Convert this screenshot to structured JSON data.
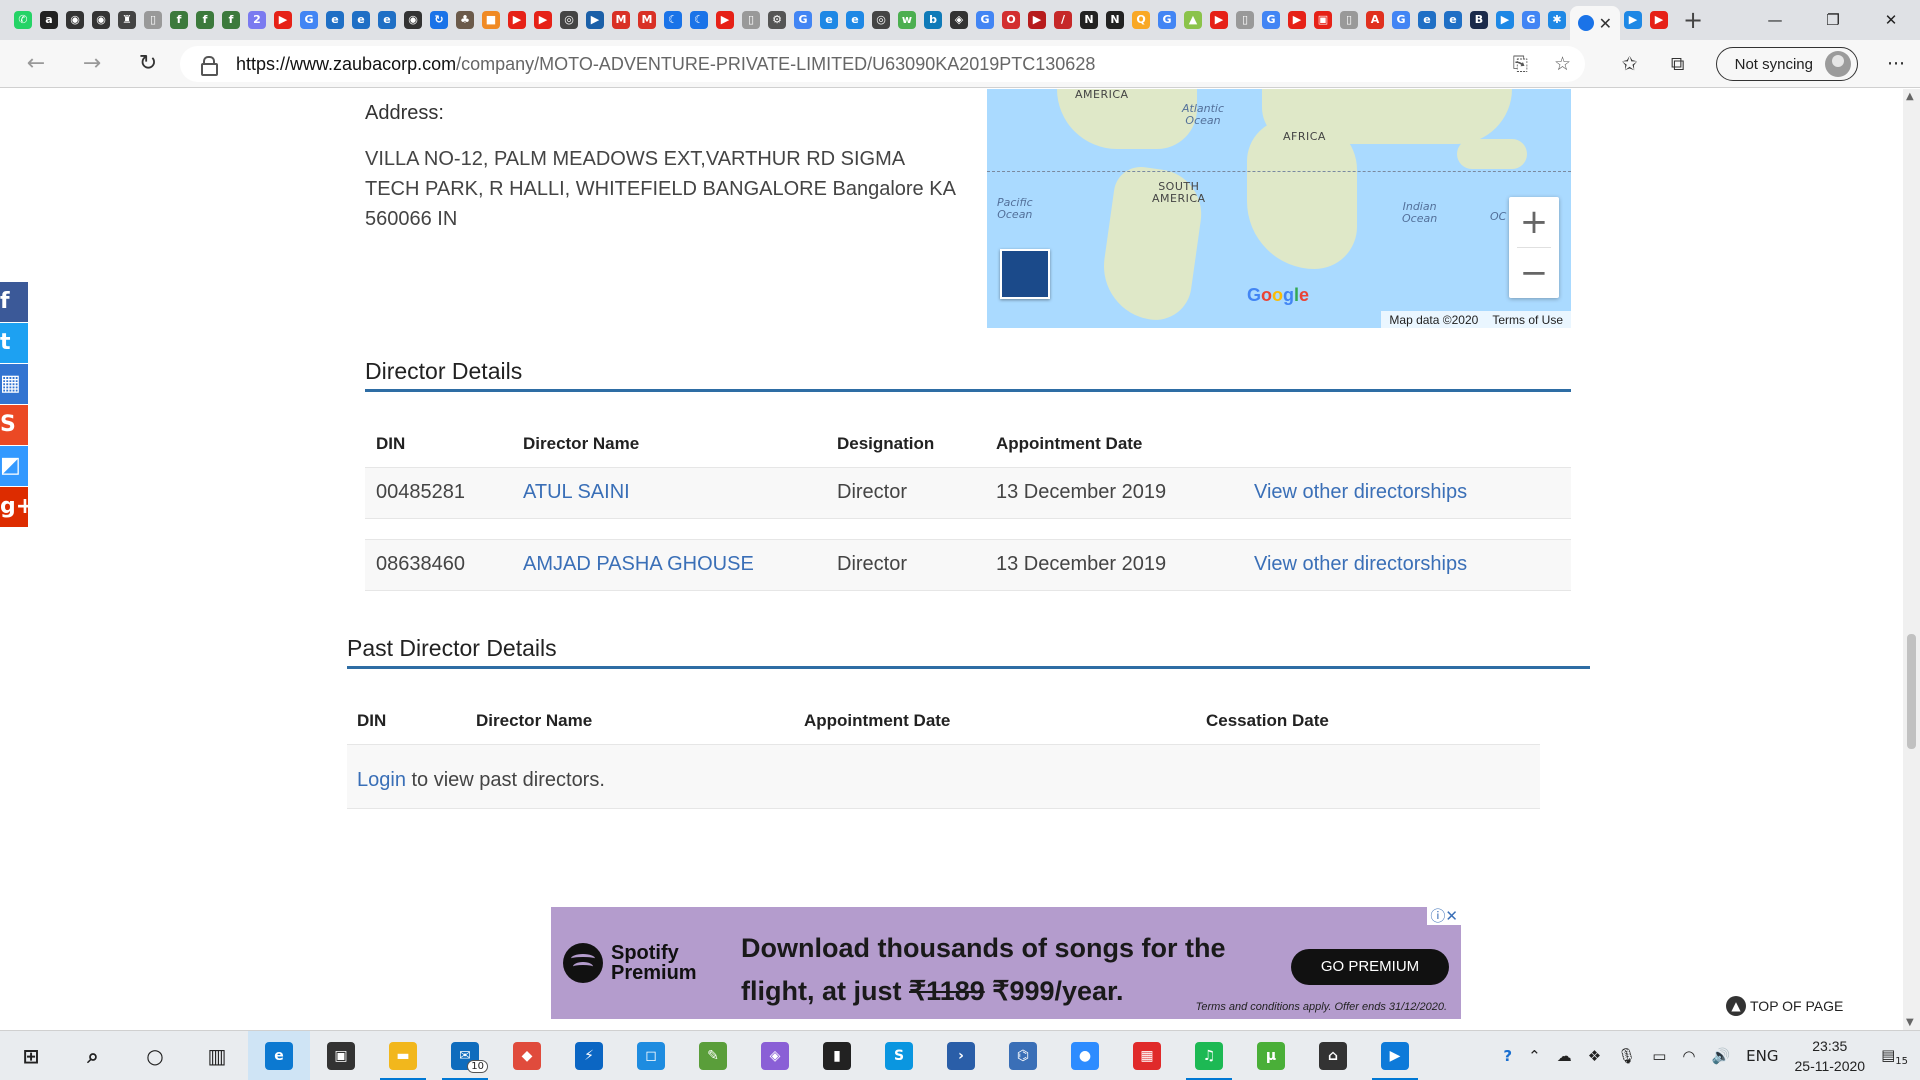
{
  "browser": {
    "active_tab_close": "✕",
    "new_tab": "+",
    "url_host": "https://www.zaubacorp.com",
    "url_path": "/company/MOTO-ADVENTURE-PRIVATE-LIMITED/U63090KA2019PTC130628",
    "profile_label": "Not syncing",
    "menu": "···",
    "pinned_tabs": [
      {
        "icon": "whatsapp-icon",
        "color": "#25d366",
        "glyph": "✆"
      },
      {
        "icon": "amazon-icon",
        "color": "#222222",
        "glyph": "a"
      },
      {
        "icon": "github-icon",
        "color": "#333333",
        "glyph": "◉"
      },
      {
        "icon": "github-icon",
        "color": "#333333",
        "glyph": "◉"
      },
      {
        "icon": "lock-icon",
        "color": "#444444",
        "glyph": "♜"
      },
      {
        "icon": "page-icon",
        "color": "#999999",
        "glyph": "▯"
      },
      {
        "icon": "calc-icon",
        "color": "#3c7a3c",
        "glyph": "f"
      },
      {
        "icon": "calc-icon",
        "color": "#3c7a3c",
        "glyph": "f"
      },
      {
        "icon": "calc-icon",
        "color": "#3c7a3c",
        "glyph": "f"
      },
      {
        "icon": "2min-icon",
        "color": "#7a7af0",
        "glyph": "2"
      },
      {
        "icon": "youtube-icon",
        "color": "#e62117",
        "glyph": "▶"
      },
      {
        "icon": "google-icon",
        "color": "#4285f4",
        "glyph": "G"
      },
      {
        "icon": "edge-legacy-icon",
        "color": "#1f6fc5",
        "glyph": "e"
      },
      {
        "icon": "edge-legacy-icon",
        "color": "#1f6fc5",
        "glyph": "e"
      },
      {
        "icon": "edge-legacy-icon",
        "color": "#1f6fc5",
        "glyph": "e"
      },
      {
        "icon": "github-icon",
        "color": "#333333",
        "glyph": "◉"
      },
      {
        "icon": "sync-icon",
        "color": "#1a73e8",
        "glyph": "↻"
      },
      {
        "icon": "bird-icon",
        "color": "#6b5a4a",
        "glyph": "♣"
      },
      {
        "icon": "box-icon",
        "color": "#f08a24",
        "glyph": "■"
      },
      {
        "icon": "youtube-icon",
        "color": "#e62117",
        "glyph": "▶"
      },
      {
        "icon": "youtube-icon",
        "color": "#e62117",
        "glyph": "▶"
      },
      {
        "icon": "chrome-icon",
        "color": "#444444",
        "glyph": "◎"
      },
      {
        "icon": "play-icon",
        "color": "#1a5fa8",
        "glyph": "▶"
      },
      {
        "icon": "gmail-icon",
        "color": "#d93025",
        "glyph": "M"
      },
      {
        "icon": "gmail-icon",
        "color": "#d93025",
        "glyph": "M"
      },
      {
        "icon": "moon-icon",
        "color": "#1a73e8",
        "glyph": "☾"
      },
      {
        "icon": "moon-icon",
        "color": "#1a73e8",
        "glyph": "☾"
      },
      {
        "icon": "youtube-icon",
        "color": "#e62117",
        "glyph": "▶"
      },
      {
        "icon": "page-icon",
        "color": "#999999",
        "glyph": "▯"
      },
      {
        "icon": "settings-icon",
        "color": "#555555",
        "glyph": "⚙"
      },
      {
        "icon": "google-icon",
        "color": "#4285f4",
        "glyph": "G"
      },
      {
        "icon": "edge-icon",
        "color": "#1e88e5",
        "glyph": "e"
      },
      {
        "icon": "edge-icon",
        "color": "#1e88e5",
        "glyph": "e"
      },
      {
        "icon": "chrome-icon",
        "color": "#444444",
        "glyph": "◎"
      },
      {
        "icon": "w3-icon",
        "color": "#4caf50",
        "glyph": "w"
      },
      {
        "icon": "bing-icon",
        "color": "#0f7ab8",
        "glyph": "b"
      },
      {
        "icon": "diamond-icon",
        "color": "#333333",
        "glyph": "◈"
      },
      {
        "icon": "google-icon",
        "color": "#4285f4",
        "glyph": "G"
      },
      {
        "icon": "opera-icon",
        "color": "#d32f2f",
        "glyph": "O"
      },
      {
        "icon": "youtube-icon",
        "color": "#b71c1c",
        "glyph": "▶"
      },
      {
        "icon": "slash-icon",
        "color": "#c62828",
        "glyph": "/"
      },
      {
        "icon": "notion-icon",
        "color": "#222222",
        "glyph": "N"
      },
      {
        "icon": "notion-icon",
        "color": "#222222",
        "glyph": "N"
      },
      {
        "icon": "search-icon",
        "color": "#f9a825",
        "glyph": "Q"
      },
      {
        "icon": "google-icon",
        "color": "#4285f4",
        "glyph": "G"
      },
      {
        "icon": "chart-icon",
        "color": "#8bc34a",
        "glyph": "▲"
      },
      {
        "icon": "youtube-icon",
        "color": "#e62117",
        "glyph": "▶"
      },
      {
        "icon": "page-icon",
        "color": "#999999",
        "glyph": "▯"
      },
      {
        "icon": "google-icon",
        "color": "#4285f4",
        "glyph": "G"
      },
      {
        "icon": "youtube-icon",
        "color": "#e62117",
        "glyph": "▶"
      },
      {
        "icon": "video-icon",
        "color": "#e62117",
        "glyph": "▣"
      },
      {
        "icon": "page-icon",
        "color": "#999999",
        "glyph": "▯"
      },
      {
        "icon": "acrobat-icon",
        "color": "#e0301e",
        "glyph": "A"
      },
      {
        "icon": "google-icon",
        "color": "#4285f4",
        "glyph": "G"
      },
      {
        "icon": "edge-legacy-icon",
        "color": "#1f6fc5",
        "glyph": "e"
      },
      {
        "icon": "edge-legacy-icon",
        "color": "#1f6fc5",
        "glyph": "e"
      },
      {
        "icon": "bh-icon",
        "color": "#1b2a4a",
        "glyph": "B"
      },
      {
        "icon": "media-icon",
        "color": "#1e88e5",
        "glyph": "▶"
      },
      {
        "icon": "google-icon",
        "color": "#4285f4",
        "glyph": "G"
      },
      {
        "icon": "bug-icon",
        "color": "#1e88e5",
        "glyph": "✱"
      }
    ],
    "after_tabs": [
      {
        "icon": "play-icon",
        "color": "#1e88e5",
        "glyph": "▶"
      },
      {
        "icon": "youtube-icon",
        "color": "#e62117",
        "glyph": "▶"
      }
    ]
  },
  "page": {
    "address_label": "Address:",
    "address_text": "VILLA NO-12, PALM MEADOWS EXT,VARTHUR RD SIGMA TECH PARK, R HALLI, WHITEFIELD BANGALORE Bangalore KA 560066 IN",
    "map": {
      "labels": {
        "america": "AMERICA",
        "atlantic": "Atlantic\nOcean",
        "africa": "AFRICA",
        "pacific": "Pacific\nOcean",
        "south_america": "SOUTH\nAMERICA",
        "indian": "Indian\nOcean",
        "oc": "OC"
      },
      "zoom_in": "+",
      "zoom_out": "−",
      "google": "Google",
      "map_data": "Map data ©2020",
      "terms": "Terms of Use"
    },
    "directors": {
      "title": "Director Details",
      "headers": [
        "DIN",
        "Director Name",
        "Designation",
        "Appointment Date"
      ],
      "rows": [
        {
          "din": "00485281",
          "name": "ATUL SAINI",
          "designation": "Director",
          "date": "13 December 2019",
          "link": "View other directorships"
        },
        {
          "din": "08638460",
          "name": "AMJAD PASHA GHOUSE",
          "designation": "Director",
          "date": "13 December 2019",
          "link": "View other directorships"
        }
      ]
    },
    "past_directors": {
      "title": "Past Director Details",
      "headers": [
        "DIN",
        "Director Name",
        "Appointment Date",
        "Cessation Date"
      ],
      "login": "Login",
      "login_suffix": " to view past directors."
    },
    "ad": {
      "brand": "Spotify\nPremium",
      "line1": "Download thousands of songs for the",
      "line2_pre": "flight, at just ",
      "old_price": "₹1189",
      "line2_post": " ₹999/year.",
      "cta": "GO PREMIUM",
      "terms": "Terms and conditions apply. Offer ends 31/12/2020."
    },
    "top_of_page": "TOP OF PAGE"
  },
  "social": [
    {
      "icon": "facebook-icon",
      "color": "#3b5998",
      "glyph": "f"
    },
    {
      "icon": "twitter-icon",
      "color": "#1da1f2",
      "glyph": "t"
    },
    {
      "icon": "delicious-icon",
      "color": "#3274d1",
      "glyph": "▦"
    },
    {
      "icon": "stumbleupon-icon",
      "color": "#eb4924",
      "glyph": "S"
    },
    {
      "icon": "delicious-icon",
      "color": "#3399ff",
      "glyph": "◩"
    },
    {
      "icon": "google-plus-icon",
      "color": "#dd2c00",
      "glyph": "g+"
    }
  ],
  "taskbar": {
    "apps": [
      {
        "icon": "windows-start-icon",
        "color": "#222222",
        "glyph": "⊞",
        "state": ""
      },
      {
        "icon": "search-icon",
        "color": "#222222",
        "glyph": "⌕",
        "state": ""
      },
      {
        "icon": "cortana-icon",
        "color": "#222222",
        "glyph": "○",
        "state": ""
      },
      {
        "icon": "task-view-icon",
        "color": "#222222",
        "glyph": "▥",
        "state": ""
      },
      {
        "icon": "edge-icon",
        "color": "#0c79d1",
        "glyph": "e",
        "state": "active"
      },
      {
        "icon": "store-icon",
        "color": "#333333",
        "glyph": "▣",
        "state": ""
      },
      {
        "icon": "file-explorer-icon",
        "color": "#f2b71c",
        "glyph": "▬",
        "state": "run"
      },
      {
        "icon": "mail-icon",
        "color": "#0f6cbd",
        "glyph": "✉",
        "state": "run",
        "badge": "10"
      },
      {
        "icon": "git-icon",
        "color": "#e04b3c",
        "glyph": "◆",
        "state": ""
      },
      {
        "icon": "powershell-icon",
        "color": "#0b66c3",
        "glyph": "⚡",
        "state": ""
      },
      {
        "icon": "vscode-icon",
        "color": "#1e8ce0",
        "glyph": "◻",
        "state": ""
      },
      {
        "icon": "notepad-icon",
        "color": "#5a9e3a",
        "glyph": "✎",
        "state": ""
      },
      {
        "icon": "diamond-app-icon",
        "color": "#8a5fd6",
        "glyph": "◈",
        "state": ""
      },
      {
        "icon": "terminal-icon",
        "color": "#222222",
        "glyph": "▮",
        "state": ""
      },
      {
        "icon": "skype-icon",
        "color": "#0a96e0",
        "glyph": "S",
        "state": ""
      },
      {
        "icon": "powershell-icon",
        "color": "#2a5ea8",
        "glyph": "›",
        "state": ""
      },
      {
        "icon": "network-icon",
        "color": "#3a6fb7",
        "glyph": "⌬",
        "state": ""
      },
      {
        "icon": "zoom-icon",
        "color": "#2d8cff",
        "glyph": "●",
        "state": ""
      },
      {
        "icon": "calendar-app-icon",
        "color": "#e02a2a",
        "glyph": "▦",
        "state": ""
      },
      {
        "icon": "spotify-icon",
        "color": "#1db954",
        "glyph": "♫",
        "state": "run"
      },
      {
        "icon": "utorrent-icon",
        "color": "#4aaf38",
        "glyph": "µ",
        "state": ""
      },
      {
        "icon": "app-icon",
        "color": "#333333",
        "glyph": "⌂",
        "state": ""
      },
      {
        "icon": "media-player-icon",
        "color": "#0e7ad9",
        "glyph": "▶",
        "state": "run"
      }
    ],
    "tray": {
      "help": "?",
      "caret": "⌃",
      "lang": "ENG",
      "time": "23:35",
      "date": "25-11-2020",
      "notif": "15"
    }
  }
}
